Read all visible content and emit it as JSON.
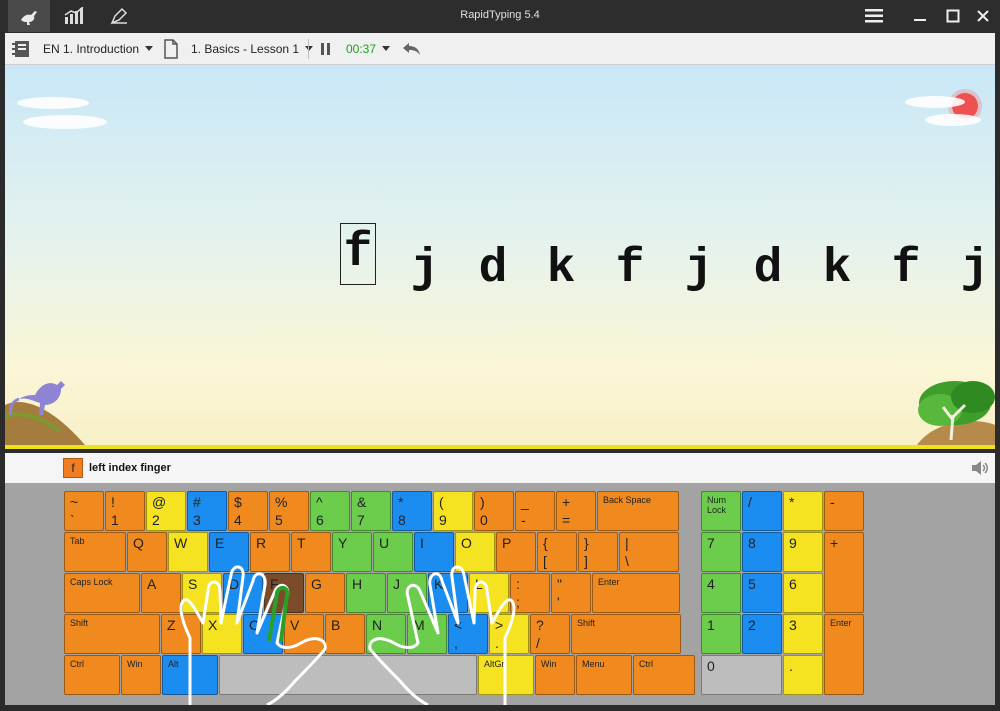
{
  "app": {
    "title": "RapidTyping 5.4"
  },
  "toolbar": {
    "course": "EN 1. Introduction",
    "lesson": "1. Basics - Lesson 1",
    "timer": "00:37"
  },
  "exercise": {
    "characters": [
      "f",
      "j",
      "d",
      "k",
      "f",
      "j",
      "d",
      "k",
      "f",
      "j"
    ],
    "current_index": 0
  },
  "hint": {
    "key": "f",
    "finger": "left index finger"
  },
  "keyboard": {
    "rows": [
      [
        {
          "t": "~",
          "b": "`",
          "c": "orange"
        },
        {
          "t": "!",
          "b": "1",
          "c": "orange"
        },
        {
          "t": "@",
          "b": "2",
          "c": "yellow"
        },
        {
          "t": "#",
          "b": "3",
          "c": "blue"
        },
        {
          "t": "$",
          "b": "4",
          "c": "orange"
        },
        {
          "t": "%",
          "b": "5",
          "c": "orange"
        },
        {
          "t": "^",
          "b": "6",
          "c": "green"
        },
        {
          "t": "&",
          "b": "7",
          "c": "green"
        },
        {
          "t": "*",
          "b": "8",
          "c": "blue"
        },
        {
          "t": "(",
          "b": "9",
          "c": "yellow"
        },
        {
          "t": ")",
          "b": "0",
          "c": "orange"
        },
        {
          "t": "_",
          "b": "-",
          "c": "orange"
        },
        {
          "t": "+",
          "b": "=",
          "c": "orange"
        },
        {
          "s": "Back Space",
          "c": "orange"
        }
      ],
      [
        {
          "s": "Tab",
          "c": "orange"
        },
        {
          "t": "Q",
          "c": "orange"
        },
        {
          "t": "W",
          "c": "yellow"
        },
        {
          "t": "E",
          "c": "blue"
        },
        {
          "t": "R",
          "c": "orange"
        },
        {
          "t": "T",
          "c": "orange"
        },
        {
          "t": "Y",
          "c": "green"
        },
        {
          "t": "U",
          "c": "green"
        },
        {
          "t": "I",
          "c": "blue"
        },
        {
          "t": "O",
          "c": "yellow"
        },
        {
          "t": "P",
          "c": "orange"
        },
        {
          "t": "{",
          "b": "[",
          "c": "orange"
        },
        {
          "t": "}",
          "b": "]",
          "c": "orange"
        },
        {
          "t": "|",
          "b": "\\",
          "c": "orange"
        }
      ],
      [
        {
          "s": "Caps Lock",
          "c": "orange"
        },
        {
          "t": "A",
          "c": "orange"
        },
        {
          "t": "S",
          "c": "yellow"
        },
        {
          "t": "D",
          "c": "blue"
        },
        {
          "t": "F",
          "c": "active"
        },
        {
          "t": "G",
          "c": "orange"
        },
        {
          "t": "H",
          "c": "green"
        },
        {
          "t": "J",
          "c": "green"
        },
        {
          "t": "K",
          "c": "blue"
        },
        {
          "t": "L",
          "c": "yellow"
        },
        {
          "t": ":",
          "b": ";",
          "c": "orange"
        },
        {
          "t": "\"",
          "b": "'",
          "c": "orange"
        },
        {
          "s": "Enter",
          "c": "orange"
        }
      ],
      [
        {
          "s": "Shift",
          "c": "orange"
        },
        {
          "t": "Z",
          "c": "orange"
        },
        {
          "t": "X",
          "c": "yellow"
        },
        {
          "t": "C",
          "c": "blue"
        },
        {
          "t": "V",
          "c": "orange"
        },
        {
          "t": "B",
          "c": "orange"
        },
        {
          "t": "N",
          "c": "green"
        },
        {
          "t": "M",
          "c": "green"
        },
        {
          "t": "<",
          "b": ",",
          "c": "blue"
        },
        {
          "t": ">",
          "b": ".",
          "c": "yellow"
        },
        {
          "t": "?",
          "b": "/",
          "c": "orange"
        },
        {
          "s": "Shift",
          "c": "orange"
        }
      ],
      [
        {
          "s": "Ctrl",
          "c": "orange"
        },
        {
          "s": "Win",
          "c": "orange"
        },
        {
          "s": "Alt",
          "c": "blue"
        },
        {
          "s": "",
          "c": "gray"
        },
        {
          "s": "AltGr",
          "c": "yellow"
        },
        {
          "s": "Win",
          "c": "orange"
        },
        {
          "s": "Menu",
          "c": "orange"
        },
        {
          "s": "Ctrl",
          "c": "orange"
        }
      ]
    ],
    "numpad": [
      {
        "s": "Num Lock",
        "c": "green"
      },
      {
        "t": "/",
        "c": "blue"
      },
      {
        "t": "*",
        "c": "yellow"
      },
      {
        "t": "-",
        "c": "orange"
      },
      {
        "t": "7",
        "c": "green"
      },
      {
        "t": "8",
        "c": "blue"
      },
      {
        "t": "9",
        "c": "yellow"
      },
      {
        "t": "+",
        "c": "orange"
      },
      {
        "t": "4",
        "c": "green"
      },
      {
        "t": "5",
        "c": "blue"
      },
      {
        "t": "6",
        "c": "yellow"
      },
      {
        "t": "1",
        "c": "green"
      },
      {
        "t": "2",
        "c": "blue"
      },
      {
        "t": "3",
        "c": "yellow"
      },
      {
        "s": "Enter",
        "c": "orange"
      },
      {
        "t": "0",
        "c": "gray"
      },
      {
        "t": ".",
        "c": "yellow"
      }
    ]
  },
  "icons": {
    "lesson_icon": "kangaroo-icon",
    "stats_icon": "chart-icon",
    "editor_icon": "pen-icon",
    "menu_icon": "hamburger-icon",
    "minimize_icon": "minimize-icon",
    "maximize_icon": "maximize-icon",
    "close_icon": "close-icon",
    "course_icon": "notebook-icon",
    "lesson_doc_icon": "document-icon",
    "pause_icon": "pause-icon",
    "undo_icon": "undo-icon",
    "speaker_icon": "speaker-icon"
  }
}
